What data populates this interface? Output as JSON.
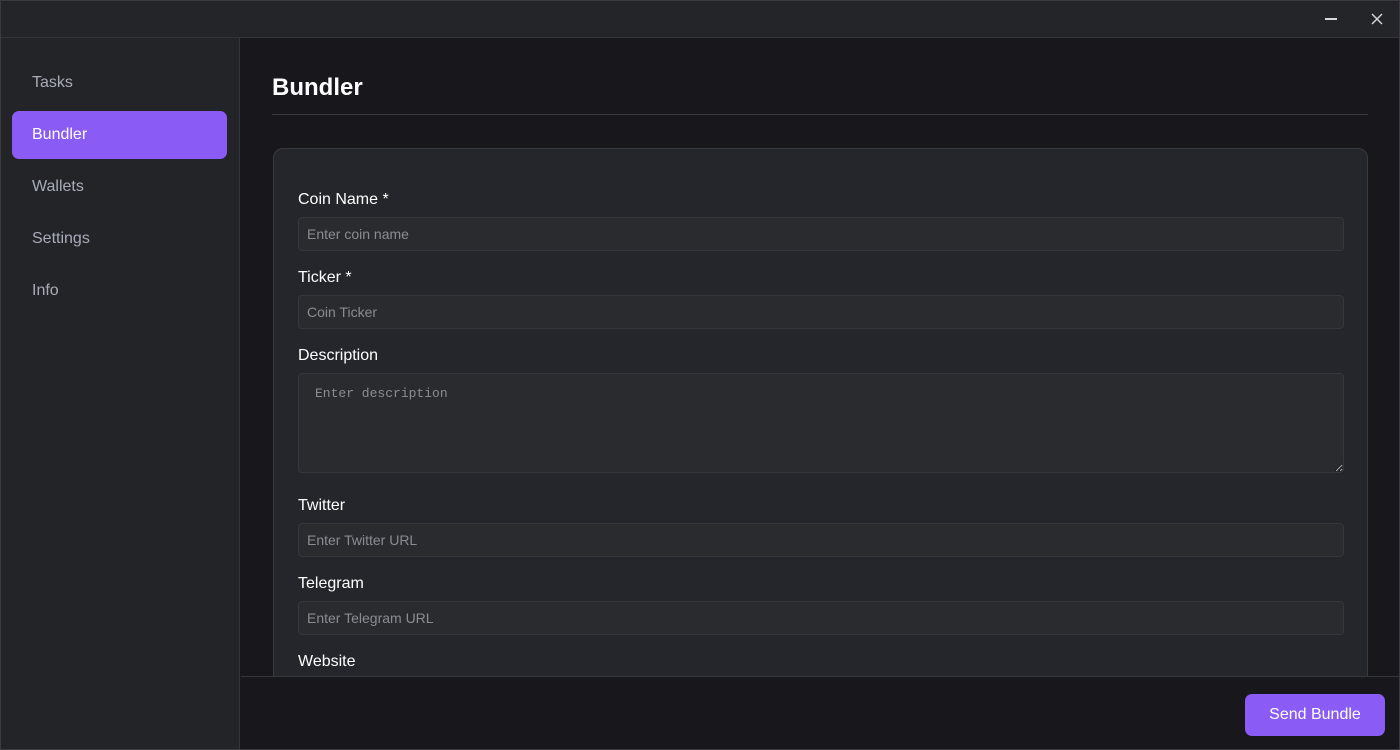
{
  "titlebar": {
    "minimize_icon": "minimize-icon",
    "close_icon": "close-icon"
  },
  "sidebar": {
    "items": [
      {
        "label": "Tasks",
        "active": false
      },
      {
        "label": "Bundler",
        "active": true
      },
      {
        "label": "Wallets",
        "active": false
      },
      {
        "label": "Settings",
        "active": false
      },
      {
        "label": "Info",
        "active": false
      }
    ]
  },
  "main": {
    "title": "Bundler",
    "form": {
      "coin_name": {
        "label": "Coin Name *",
        "placeholder": "Enter coin name",
        "value": ""
      },
      "ticker": {
        "label": "Ticker *",
        "placeholder": "Coin Ticker",
        "value": ""
      },
      "description": {
        "label": "Description",
        "placeholder": "Enter description",
        "value": ""
      },
      "twitter": {
        "label": "Twitter",
        "placeholder": "Enter Twitter URL",
        "value": ""
      },
      "telegram": {
        "label": "Telegram",
        "placeholder": "Enter Telegram URL",
        "value": ""
      },
      "website": {
        "label": "Website"
      }
    }
  },
  "footer": {
    "send_label": "Send Bundle"
  },
  "colors": {
    "accent": "#8a5cf5",
    "background": "#18181c",
    "sidebar": "#232428",
    "card": "#25262b"
  }
}
